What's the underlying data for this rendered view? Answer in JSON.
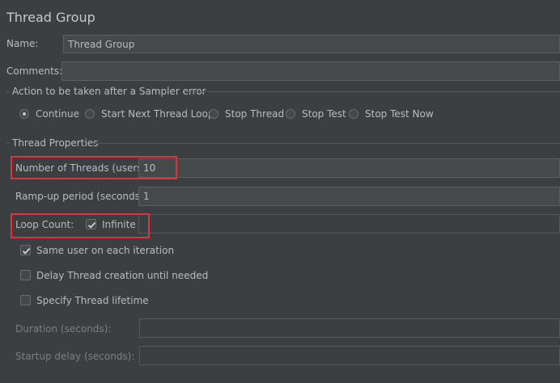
{
  "panel": {
    "title": "Thread Group"
  },
  "name": {
    "label": "Name:",
    "value": "Thread Group"
  },
  "comments": {
    "label": "Comments:",
    "value": ""
  },
  "sampler_error": {
    "group_label": "Action to be taken after a Sampler error",
    "options": [
      "Continue",
      "Start Next Thread Loop",
      "Stop Thread",
      "Stop Test",
      "Stop Test Now"
    ],
    "selected": "Continue"
  },
  "thread_properties": {
    "group_label": "Thread Properties",
    "num_threads": {
      "label": "Number of Threads (users):",
      "value": "10"
    },
    "ramp_up": {
      "label": "Ramp-up period (seconds):",
      "value": "1"
    },
    "loop_count": {
      "label": "Loop Count:",
      "infinite_label": "Infinite",
      "infinite_checked": true,
      "value": ""
    },
    "same_user": {
      "label": "Same user on each iteration",
      "checked": true
    },
    "delay_creation": {
      "label": "Delay Thread creation until needed",
      "checked": false
    },
    "specify_lifetime": {
      "label": "Specify Thread lifetime",
      "checked": false
    },
    "duration": {
      "label": "Duration (seconds):",
      "value": ""
    },
    "startup_delay": {
      "label": "Startup delay (seconds):",
      "value": ""
    }
  },
  "colors": {
    "highlight": "#e0343a",
    "background": "#3c3f41"
  }
}
